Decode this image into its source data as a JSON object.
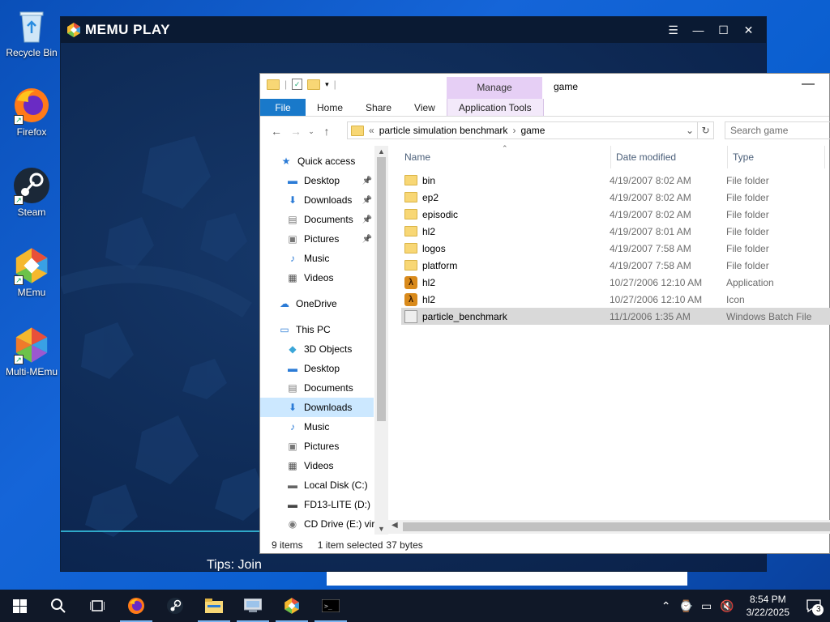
{
  "desktop": {
    "icons": [
      {
        "label": "Recycle Bin",
        "icon": "recycle-bin-icon"
      },
      {
        "label": "Firefox",
        "icon": "firefox-icon"
      },
      {
        "label": "Steam",
        "icon": "steam-icon"
      },
      {
        "label": "MEmu",
        "icon": "memu-icon"
      },
      {
        "label": "Multi-MEmu",
        "icon": "multi-memu-icon"
      }
    ]
  },
  "memu": {
    "logo_text": "MEMU PLAY",
    "tips_text": "Tips: Join"
  },
  "explorer": {
    "title": "game",
    "manage_tab": "Manage",
    "tabs": [
      "File",
      "Home",
      "Share",
      "View",
      "Application Tools"
    ],
    "address": {
      "prefix": "«",
      "parts": [
        "particle simulation benchmark",
        "game"
      ]
    },
    "search_placeholder": "Search game",
    "nav": [
      {
        "label": "Quick access",
        "icon": "star-icon",
        "pin": false
      },
      {
        "label": "Desktop",
        "icon": "desktop-icon",
        "pin": true
      },
      {
        "label": "Downloads",
        "icon": "download-icon",
        "pin": true
      },
      {
        "label": "Documents",
        "icon": "documents-icon",
        "pin": true
      },
      {
        "label": "Pictures",
        "icon": "pictures-icon",
        "pin": true
      },
      {
        "label": "Music",
        "icon": "music-icon",
        "pin": false
      },
      {
        "label": "Videos",
        "icon": "videos-icon",
        "pin": false
      },
      {
        "label": "OneDrive",
        "icon": "cloud-icon",
        "pin": false
      },
      {
        "label": "This PC",
        "icon": "pc-icon",
        "pin": false
      },
      {
        "label": "3D Objects",
        "icon": "cube-icon",
        "pin": false
      },
      {
        "label": "Desktop",
        "icon": "desktop-icon",
        "pin": false
      },
      {
        "label": "Documents",
        "icon": "documents-icon",
        "pin": false
      },
      {
        "label": "Downloads",
        "icon": "download-icon",
        "pin": false
      },
      {
        "label": "Music",
        "icon": "music-icon",
        "pin": false
      },
      {
        "label": "Pictures",
        "icon": "pictures-icon",
        "pin": false
      },
      {
        "label": "Videos",
        "icon": "videos-icon",
        "pin": false
      },
      {
        "label": "Local Disk (C:)",
        "icon": "disk-icon",
        "pin": false
      },
      {
        "label": "FD13-LITE (D:)",
        "icon": "drive-icon",
        "pin": false
      },
      {
        "label": "CD Drive (E:) virt",
        "icon": "cd-icon",
        "pin": false
      }
    ],
    "selected_nav_index": 12,
    "columns": {
      "name": "Name",
      "date": "Date modified",
      "type": "Type"
    },
    "files": [
      {
        "name": "bin",
        "date": "4/19/2007 8:02 AM",
        "type": "File folder",
        "icon": "folder-icon"
      },
      {
        "name": "ep2",
        "date": "4/19/2007 8:02 AM",
        "type": "File folder",
        "icon": "folder-icon"
      },
      {
        "name": "episodic",
        "date": "4/19/2007 8:02 AM",
        "type": "File folder",
        "icon": "folder-icon"
      },
      {
        "name": "hl2",
        "date": "4/19/2007 8:01 AM",
        "type": "File folder",
        "icon": "folder-icon"
      },
      {
        "name": "logos",
        "date": "4/19/2007 7:58 AM",
        "type": "File folder",
        "icon": "folder-icon"
      },
      {
        "name": "platform",
        "date": "4/19/2007 7:58 AM",
        "type": "File folder",
        "icon": "folder-icon"
      },
      {
        "name": "hl2",
        "date": "10/27/2006 12:10 AM",
        "type": "Application",
        "icon": "hl2-app-icon"
      },
      {
        "name": "hl2",
        "date": "10/27/2006 12:10 AM",
        "type": "Icon",
        "icon": "hl2-app-icon"
      },
      {
        "name": "particle_benchmark",
        "date": "11/1/2006 1:35 AM",
        "type": "Windows Batch File",
        "icon": "batch-file-icon"
      }
    ],
    "selected_file_index": 8,
    "status": {
      "items": "9 items",
      "selected": "1 item selected",
      "size": "37 bytes"
    }
  },
  "taskbar": {
    "clock_time": "8:54 PM",
    "clock_date": "3/22/2025",
    "notification_count": "3"
  },
  "colors": {
    "accent": "#1979ca",
    "manage_tab": "#e6cff5",
    "taskbar": "#101828"
  }
}
